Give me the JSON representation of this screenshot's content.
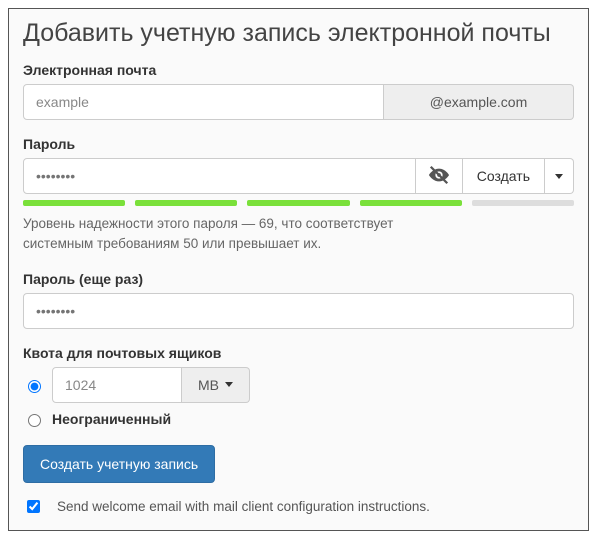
{
  "title": "Добавить учетную запись электронной почты",
  "email": {
    "label": "Электронная почта",
    "value": "example",
    "domain": "@example.com"
  },
  "password": {
    "label": "Пароль",
    "value": "••••••••",
    "reveal_icon": "eye-off-icon",
    "generate_label": "Создать",
    "strength_segments": 5,
    "strength_filled": 4,
    "strength_text_1": "Уровень надежности этого пароля — 69, что соответствует",
    "strength_text_2": "системным требованиям 50 или превышает их."
  },
  "password_confirm": {
    "label": "Пароль (еще раз)",
    "value": "••••••••"
  },
  "quota": {
    "label": "Квота для почтовых ящиков",
    "value": "1024",
    "unit": "MB",
    "unlimited_label": "Неограниченный",
    "selected": "limited"
  },
  "submit": {
    "label": "Создать учетную запись"
  },
  "welcome": {
    "checked": true,
    "label": "Send welcome email with mail client configuration instructions."
  },
  "colors": {
    "primary": "#337ab7",
    "strength_on": "#7ae03a"
  }
}
